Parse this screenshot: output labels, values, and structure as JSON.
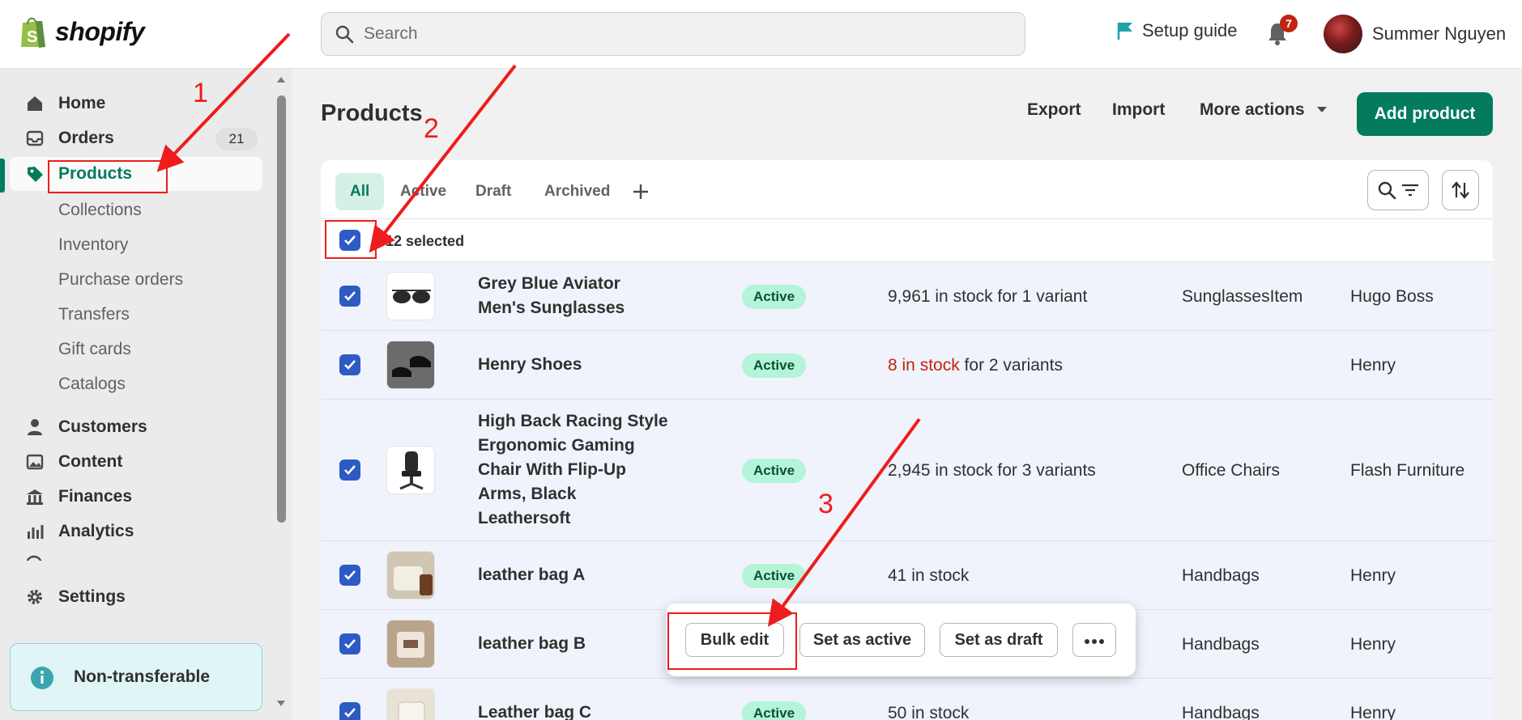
{
  "topbar": {
    "logo_text": "shopify",
    "search_placeholder": "Search",
    "setup_guide": "Setup guide",
    "notification_count": "7",
    "user_name": "Summer Nguyen"
  },
  "sidebar": {
    "items": [
      {
        "label": "Home",
        "icon": "home-icon"
      },
      {
        "label": "Orders",
        "icon": "inbox-icon",
        "count": "21"
      },
      {
        "label": "Products",
        "icon": "tag-icon",
        "active": true
      }
    ],
    "sub_items": [
      "Collections",
      "Inventory",
      "Purchase orders",
      "Transfers",
      "Gift cards",
      "Catalogs"
    ],
    "items2": [
      {
        "label": "Customers",
        "icon": "person-icon"
      },
      {
        "label": "Content",
        "icon": "image-icon"
      },
      {
        "label": "Finances",
        "icon": "bank-icon"
      },
      {
        "label": "Analytics",
        "icon": "bar-chart-icon"
      }
    ],
    "settings": "Settings",
    "notice": "Non-transferable"
  },
  "header": {
    "title": "Products",
    "export": "Export",
    "import": "Import",
    "more_actions": "More actions",
    "add_product": "Add product"
  },
  "tabs": [
    "All",
    "Active",
    "Draft",
    "Archived"
  ],
  "selection": {
    "text": "12 selected"
  },
  "products": [
    {
      "name_lines": [
        "Grey Blue Aviator",
        "Men's Sunglasses"
      ],
      "status": "Active",
      "stock": "9,961 in stock for 1 variant",
      "type": "SunglassesItem",
      "vendor": "Hugo Boss"
    },
    {
      "name_lines": [
        "Henry Shoes"
      ],
      "status": "Active",
      "stock_low": "8 in stock",
      "stock_rest": " for 2 variants",
      "type": "",
      "vendor": "Henry"
    },
    {
      "name_lines": [
        "High Back Racing Style",
        "Ergonomic Gaming",
        "Chair With Flip-Up",
        "Arms, Black",
        "Leathersoft"
      ],
      "status": "Active",
      "stock": "2,945 in stock for 3 variants",
      "type": "Office Chairs",
      "vendor": "Flash Furniture"
    },
    {
      "name_lines": [
        "leather bag A"
      ],
      "status": "Active",
      "stock": "41 in stock",
      "type": "Handbags",
      "vendor": "Henry"
    },
    {
      "name_lines": [
        "leather bag B"
      ],
      "status": "Active",
      "stock": "",
      "type": "Handbags",
      "vendor": "Henry"
    },
    {
      "name_lines": [
        "Leather bag C"
      ],
      "status": "Active",
      "stock": "50 in stock",
      "type": "Handbags",
      "vendor": "Henry"
    }
  ],
  "bulk_actions": {
    "bulk_edit": "Bulk edit",
    "set_active": "Set as active",
    "set_draft": "Set as draft"
  },
  "annotations": {
    "step1": "1",
    "step2": "2",
    "step3": "3",
    "color": "#ee1c1c"
  },
  "colors": {
    "brand_green": "#047b5d",
    "checkbox_blue": "#2d5bc3",
    "low_stock_red": "#c2240f"
  }
}
